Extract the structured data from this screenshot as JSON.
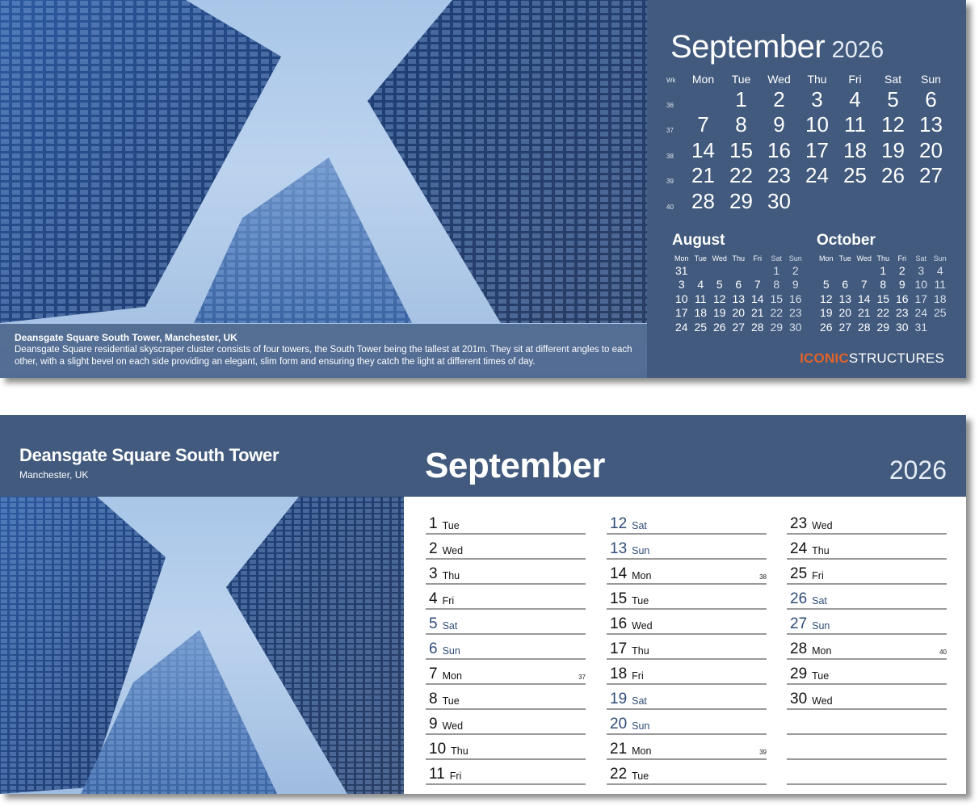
{
  "top": {
    "caption": {
      "title": "Deansgate Square South Tower, Manchester, UK",
      "text": "Deansgate Square residential skyscraper cluster consists of four towers, the South Tower being the tallest at 201m. They sit at different angles to each other, with a slight bevel on each side providing an elegant, slim form and ensuring they catch the light at different times of day."
    },
    "month": "September",
    "year": "2026",
    "wk_label": "Wk",
    "weekdays": [
      "Mon",
      "Tue",
      "Wed",
      "Thu",
      "Fri",
      "Sat",
      "Sun"
    ],
    "weeks": [
      {
        "wk": "36",
        "days": [
          "",
          "1",
          "2",
          "3",
          "4",
          "5",
          "6"
        ]
      },
      {
        "wk": "37",
        "days": [
          "7",
          "8",
          "9",
          "10",
          "11",
          "12",
          "13"
        ]
      },
      {
        "wk": "38",
        "days": [
          "14",
          "15",
          "16",
          "17",
          "18",
          "19",
          "20"
        ]
      },
      {
        "wk": "39",
        "days": [
          "21",
          "22",
          "23",
          "24",
          "25",
          "26",
          "27"
        ]
      },
      {
        "wk": "40",
        "days": [
          "28",
          "29",
          "30",
          "",
          "",
          "",
          ""
        ]
      }
    ],
    "mini_calendars": [
      {
        "title": "August",
        "weekdays": [
          "Mon",
          "Tue",
          "Wed",
          "Thu",
          "Fri",
          "Sat",
          "Sun"
        ],
        "weeks": [
          [
            "31",
            "",
            "",
            "",
            "",
            "1",
            "2"
          ],
          [
            "3",
            "4",
            "5",
            "6",
            "7",
            "8",
            "9"
          ],
          [
            "10",
            "11",
            "12",
            "13",
            "14",
            "15",
            "16"
          ],
          [
            "17",
            "18",
            "19",
            "20",
            "21",
            "22",
            "23"
          ],
          [
            "24",
            "25",
            "26",
            "27",
            "28",
            "29",
            "30"
          ]
        ]
      },
      {
        "title": "October",
        "weekdays": [
          "Mon",
          "Tue",
          "Wed",
          "Thu",
          "Fri",
          "Sat",
          "Sun"
        ],
        "weeks": [
          [
            "",
            "",
            "",
            "1",
            "2",
            "3",
            "4"
          ],
          [
            "5",
            "6",
            "7",
            "8",
            "9",
            "10",
            "11"
          ],
          [
            "12",
            "13",
            "14",
            "15",
            "16",
            "17",
            "18"
          ],
          [
            "19",
            "20",
            "21",
            "22",
            "23",
            "24",
            "25"
          ],
          [
            "26",
            "27",
            "28",
            "29",
            "30",
            "31",
            ""
          ]
        ]
      }
    ],
    "brand": {
      "part1": "ICONIC",
      "part2": "STRUCTURES"
    }
  },
  "bottom": {
    "title": "Deansgate Square South Tower",
    "subtitle": "Manchester, UK",
    "month": "September",
    "year": "2026",
    "columns": [
      [
        {
          "num": "1",
          "day": "Tue",
          "weekend": false,
          "wk": ""
        },
        {
          "num": "2",
          "day": "Wed",
          "weekend": false,
          "wk": ""
        },
        {
          "num": "3",
          "day": "Thu",
          "weekend": false,
          "wk": ""
        },
        {
          "num": "4",
          "day": "Fri",
          "weekend": false,
          "wk": ""
        },
        {
          "num": "5",
          "day": "Sat",
          "weekend": true,
          "wk": ""
        },
        {
          "num": "6",
          "day": "Sun",
          "weekend": true,
          "wk": ""
        },
        {
          "num": "7",
          "day": "Mon",
          "weekend": false,
          "wk": "37"
        },
        {
          "num": "8",
          "day": "Tue",
          "weekend": false,
          "wk": ""
        },
        {
          "num": "9",
          "day": "Wed",
          "weekend": false,
          "wk": ""
        },
        {
          "num": "10",
          "day": "Thu",
          "weekend": false,
          "wk": ""
        },
        {
          "num": "11",
          "day": "Fri",
          "weekend": false,
          "wk": ""
        }
      ],
      [
        {
          "num": "12",
          "day": "Sat",
          "weekend": true,
          "wk": ""
        },
        {
          "num": "13",
          "day": "Sun",
          "weekend": true,
          "wk": ""
        },
        {
          "num": "14",
          "day": "Mon",
          "weekend": false,
          "wk": "38"
        },
        {
          "num": "15",
          "day": "Tue",
          "weekend": false,
          "wk": ""
        },
        {
          "num": "16",
          "day": "Wed",
          "weekend": false,
          "wk": ""
        },
        {
          "num": "17",
          "day": "Thu",
          "weekend": false,
          "wk": ""
        },
        {
          "num": "18",
          "day": "Fri",
          "weekend": false,
          "wk": ""
        },
        {
          "num": "19",
          "day": "Sat",
          "weekend": true,
          "wk": ""
        },
        {
          "num": "20",
          "day": "Sun",
          "weekend": true,
          "wk": ""
        },
        {
          "num": "21",
          "day": "Mon",
          "weekend": false,
          "wk": "39"
        },
        {
          "num": "22",
          "day": "Tue",
          "weekend": false,
          "wk": ""
        }
      ],
      [
        {
          "num": "23",
          "day": "Wed",
          "weekend": false,
          "wk": ""
        },
        {
          "num": "24",
          "day": "Thu",
          "weekend": false,
          "wk": ""
        },
        {
          "num": "25",
          "day": "Fri",
          "weekend": false,
          "wk": ""
        },
        {
          "num": "26",
          "day": "Sat",
          "weekend": true,
          "wk": ""
        },
        {
          "num": "27",
          "day": "Sun",
          "weekend": true,
          "wk": ""
        },
        {
          "num": "28",
          "day": "Mon",
          "weekend": false,
          "wk": "40"
        },
        {
          "num": "29",
          "day": "Tue",
          "weekend": false,
          "wk": ""
        },
        {
          "num": "30",
          "day": "Wed",
          "weekend": false,
          "wk": ""
        },
        {
          "num": "",
          "day": "",
          "weekend": false,
          "wk": ""
        },
        {
          "num": "",
          "day": "",
          "weekend": false,
          "wk": ""
        },
        {
          "num": "",
          "day": "",
          "weekend": false,
          "wk": ""
        }
      ]
    ]
  },
  "colors": {
    "panel": "#415a7d",
    "brand_accent": "#e0632b",
    "weekend_text": "#2f4c78",
    "rule_line": "#9a9a9a"
  },
  "images": {
    "top_photo": "skyscrapers-looking-up",
    "bottom_photo": "skyscrapers-looking-up"
  }
}
